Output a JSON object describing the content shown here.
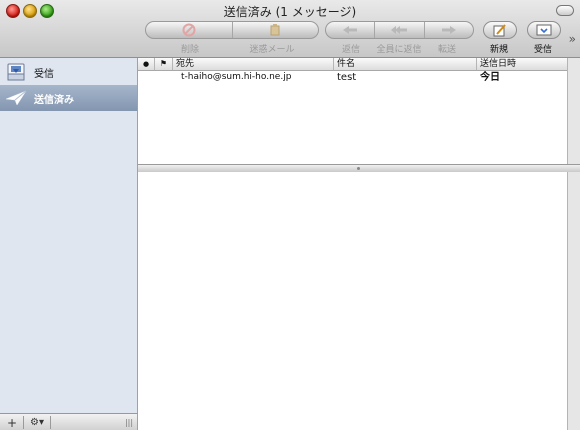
{
  "window": {
    "title": "送信済み (1 メッセージ)"
  },
  "toolbar": {
    "delete_label": "削除",
    "junk_label": "迷惑メール",
    "reply_label": "返信",
    "reply_all_label": "全員に返信",
    "forward_label": "転送",
    "new_label": "新規",
    "get_mail_label": "受信",
    "overflow_glyph": "»"
  },
  "sidebar": {
    "items": [
      {
        "label": "受信",
        "icon": "inbox-icon",
        "selected": false
      },
      {
        "label": "送信済み",
        "icon": "sent-icon",
        "selected": true
      }
    ],
    "add_glyph": "+",
    "action_glyph": "⚙▾",
    "resize_glyph": "|||"
  },
  "message_list": {
    "columns": {
      "unread": "●",
      "flag": "⚑",
      "to": "宛先",
      "subject": "件名",
      "date": "送信日時"
    },
    "rows": [
      {
        "to": "t-haiho@sum.hi-ho.ne.jp",
        "subject": "test",
        "date": "今日"
      }
    ]
  },
  "colors": {
    "sidebar_bg": "#dfe6f0",
    "selection": "#8396b0",
    "disabled_text": "#9a9a9a"
  }
}
